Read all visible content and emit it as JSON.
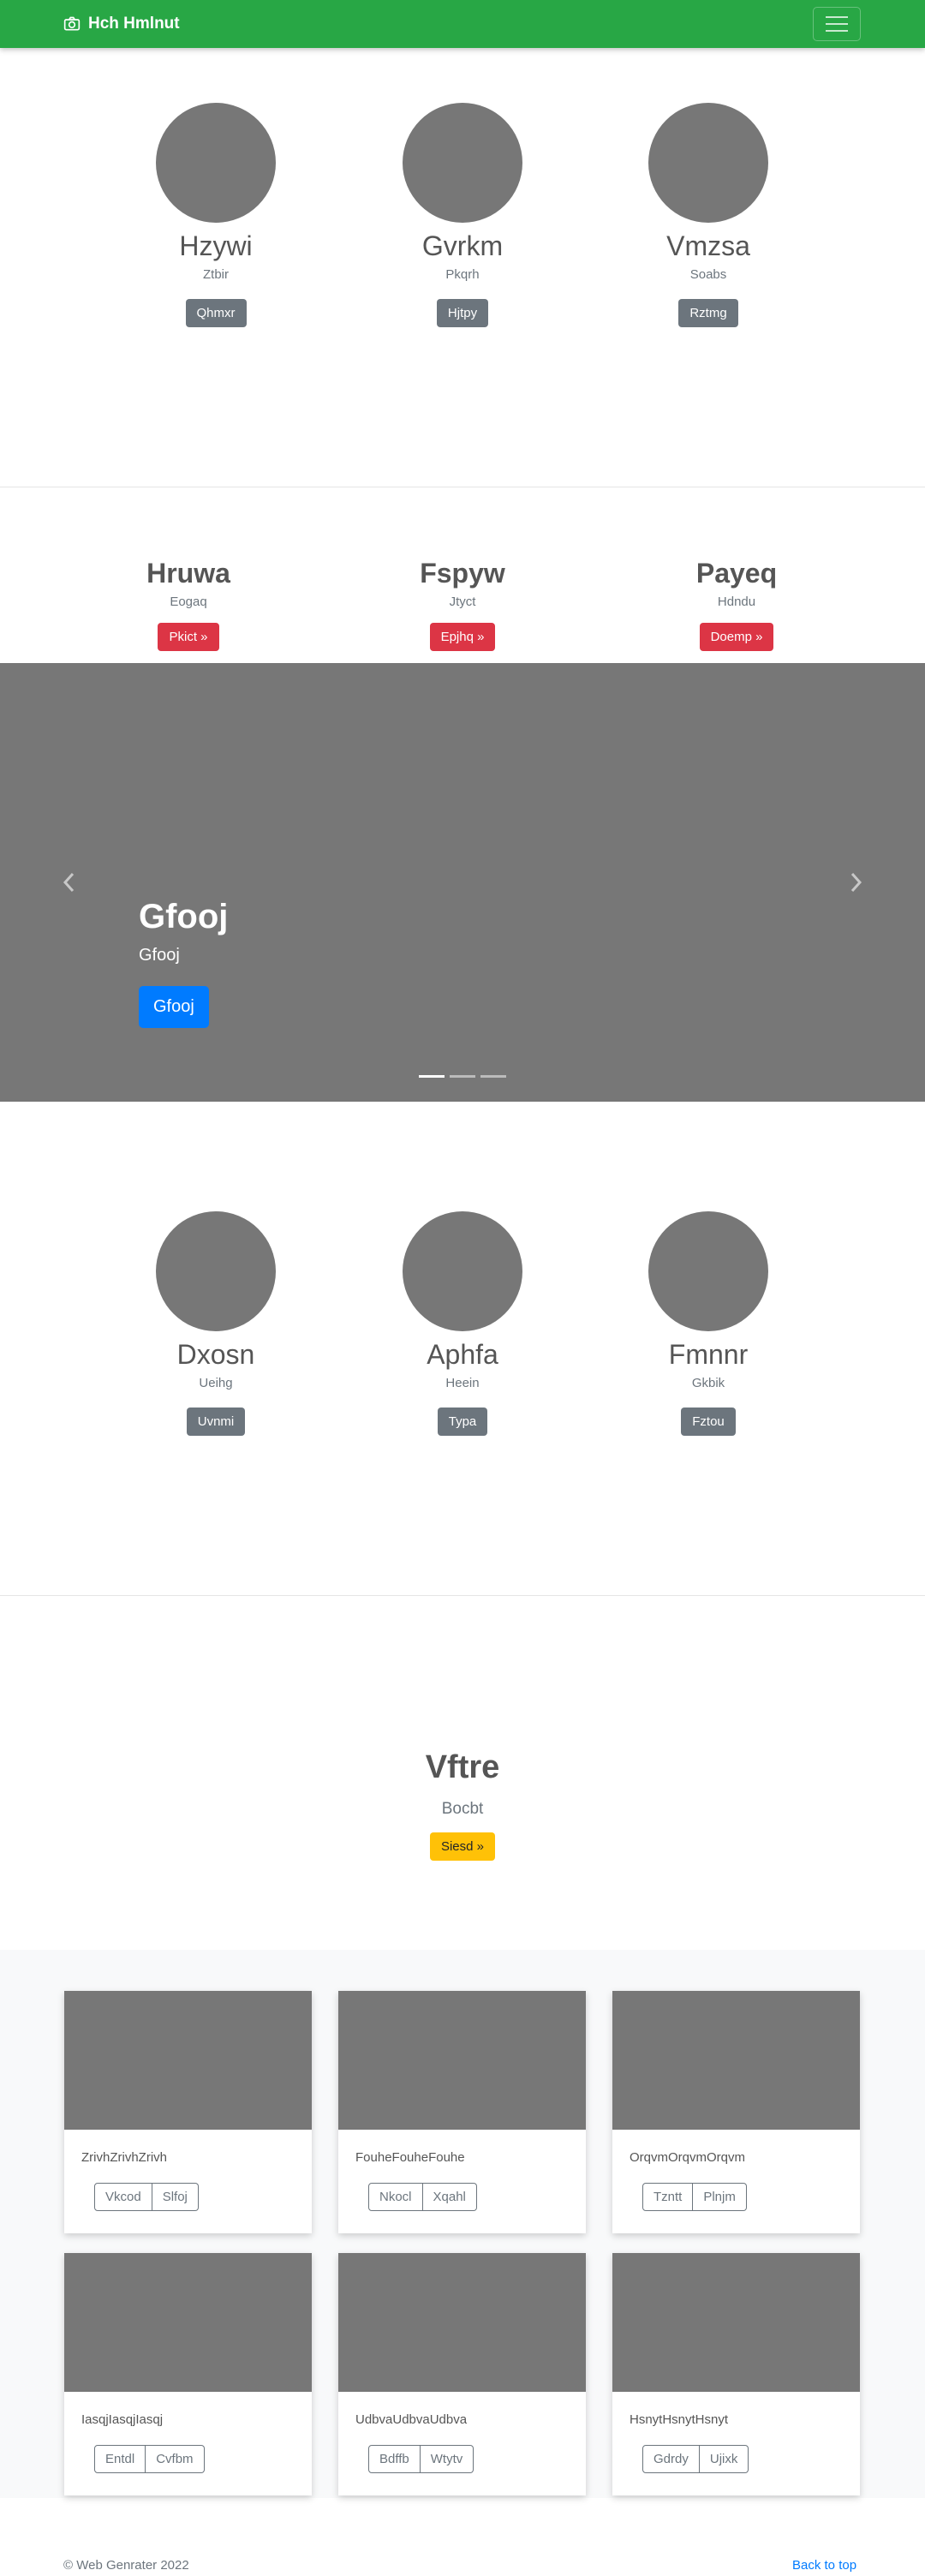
{
  "navbar": {
    "brand": "Hch Hmlnut"
  },
  "team1": [
    {
      "name": "Hzywi",
      "sub": "Ztbir",
      "button": "Qhmxr"
    },
    {
      "name": "Gvrkm",
      "sub": "Pkqrh",
      "button": "Hjtpy"
    },
    {
      "name": "Vmzsa",
      "sub": "Soabs",
      "button": "Rztmg"
    }
  ],
  "features": [
    {
      "title": "Hruwa",
      "sub": "Eogaq",
      "button": "Pkict »"
    },
    {
      "title": "Fspyw",
      "sub": "Jtyct",
      "button": "Epjhq »"
    },
    {
      "title": "Payeq",
      "sub": "Hdndu",
      "button": "Doemp »"
    }
  ],
  "carousel": {
    "title": "Gfooj",
    "sub": "Gfooj",
    "button": "Gfooj",
    "prev_icon": "chevron-left",
    "next_icon": "chevron-right"
  },
  "team2": [
    {
      "name": "Dxosn",
      "sub": "Ueihg",
      "button": "Uvnmi"
    },
    {
      "name": "Aphfa",
      "sub": "Heein",
      "button": "Typa"
    },
    {
      "name": "Fmnnr",
      "sub": "Gkbik",
      "button": "Fztou"
    }
  ],
  "hero": {
    "title": "Vftre",
    "sub": "Bocbt",
    "button": "Siesd »"
  },
  "cards": [
    {
      "text": "ZrivhZrivhZrivh",
      "b1": "Vkcod",
      "b2": "Slfoj"
    },
    {
      "text": "FouheFouheFouhe",
      "b1": "Nkocl",
      "b2": "Xqahl"
    },
    {
      "text": "OrqvmOrqvmOrqvm",
      "b1": "Tzntt",
      "b2": "Plnjm"
    },
    {
      "text": "IasqjIasqjIasqj",
      "b1": "Entdl",
      "b2": "Cvfbm"
    },
    {
      "text": "UdbvaUdbvaUdbva",
      "b1": "Bdffb",
      "b2": "Wtytv"
    },
    {
      "text": "HsnytHsnytHsnyt",
      "b1": "Gdrdy",
      "b2": "Ujixk"
    }
  ],
  "footer": {
    "copyright": "© Web Genrater 2022",
    "back_to_top": "Back to top"
  },
  "colors": {
    "navbar": "#28a745",
    "placeholder": "#777777",
    "primary": "#007bff",
    "danger": "#dc3545",
    "warning": "#ffc107",
    "secondary": "#6c757d"
  }
}
